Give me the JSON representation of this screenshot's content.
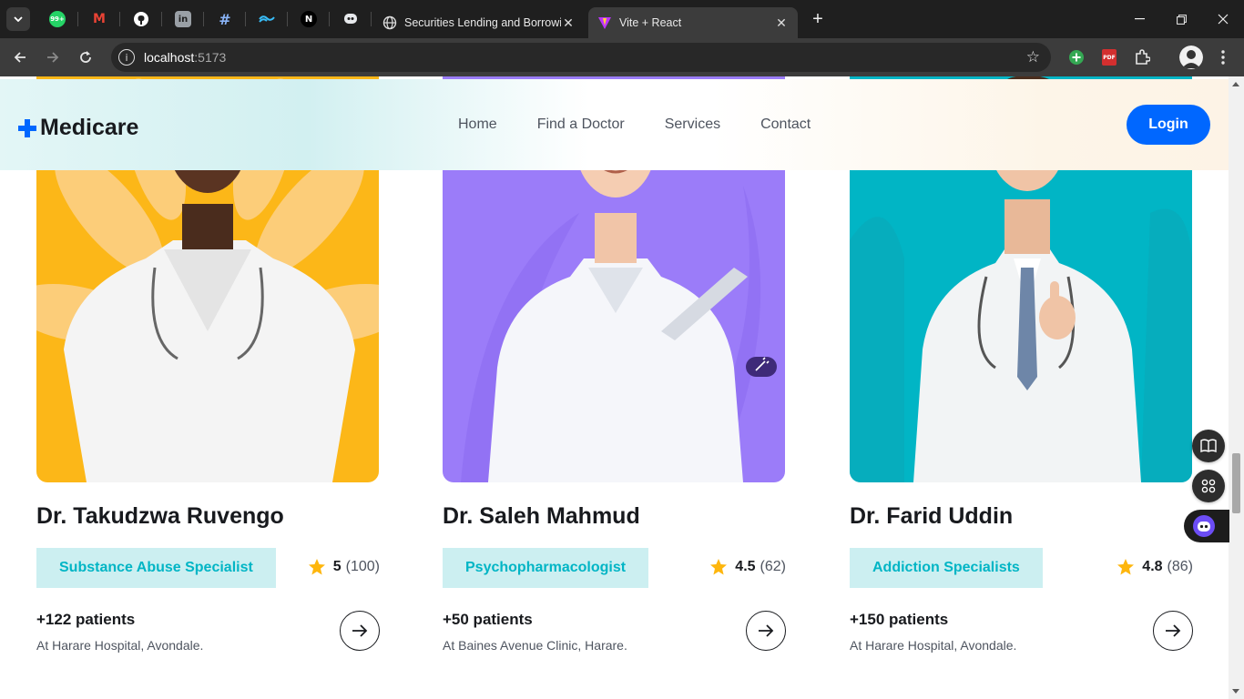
{
  "browser": {
    "pinned_tabs": [
      {
        "name": "whatsapp-icon",
        "glyph": "99+",
        "color": "#25d366"
      },
      {
        "name": "gmail-icon",
        "glyph": "M",
        "color": "#ea4335"
      },
      {
        "name": "github-icon",
        "glyph": "",
        "color": "#ffffff"
      },
      {
        "name": "linkedin-icon",
        "glyph": "in",
        "color": "#9aa0a6"
      },
      {
        "name": "slack-icon",
        "glyph": "#",
        "color": "#8ab4f8"
      },
      {
        "name": "tailwind-icon",
        "glyph": "~",
        "color": "#38bdf8"
      },
      {
        "name": "nextjs-icon",
        "glyph": "N",
        "color": "#ffffff"
      },
      {
        "name": "chatbot-icon",
        "glyph": "",
        "color": "#e8eaed"
      }
    ],
    "tabs": [
      {
        "title": "Securities Lending and Borrowin",
        "active": false
      },
      {
        "title": "Vite + React",
        "active": true
      }
    ],
    "url_host": "localhost",
    "url_port": ":5173"
  },
  "header": {
    "logo": "Medicare",
    "nav": [
      "Home",
      "Find a Doctor",
      "Services",
      "Contact"
    ],
    "login": "Login"
  },
  "doctors": [
    {
      "name": "Dr. Takudzwa Ruvengo",
      "specialty": "Substance Abuse Specialist",
      "rating": "5",
      "reviews": "(100)",
      "patients": "+122 patients",
      "location": "At Harare Hospital, Avondale.",
      "bg": "#fcb718"
    },
    {
      "name": "Dr. Saleh Mahmud",
      "specialty": "Psychopharmacologist",
      "rating": "4.5",
      "reviews": "(62)",
      "patients": "+50 patients",
      "location": "At Baines Avenue Clinic, Harare.",
      "bg": "#9b7cf9"
    },
    {
      "name": "Dr. Farid Uddin",
      "specialty": "Addiction Specialists",
      "rating": "4.8",
      "reviews": "(86)",
      "patients": "+150 patients",
      "location": "At Harare Hospital, Avondale.",
      "bg": "#01b5c5"
    }
  ],
  "colors": {
    "primary": "#0067ff",
    "teal": "#01b5c5",
    "star": "#feb60d"
  }
}
